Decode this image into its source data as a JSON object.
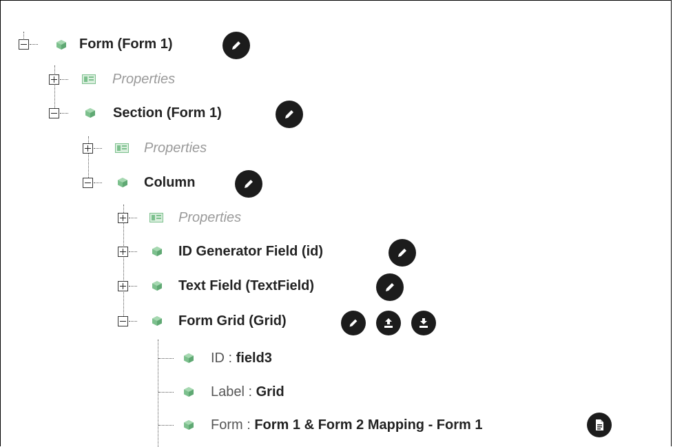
{
  "tree": {
    "root": {
      "label": "Form (Form 1)"
    },
    "root_properties": {
      "label": "Properties"
    },
    "section": {
      "label": "Section (Form 1)"
    },
    "section_properties": {
      "label": "Properties"
    },
    "column": {
      "label": "Column"
    },
    "column_properties": {
      "label": "Properties"
    },
    "id_generator": {
      "label": "ID Generator Field (id)"
    },
    "text_field": {
      "label": "Text Field (TextField)"
    },
    "form_grid": {
      "label": "Form Grid (Grid)"
    },
    "grid_props": [
      {
        "key": "ID",
        "sep": " : ",
        "value": "field3"
      },
      {
        "key": "Label",
        "sep": " : ",
        "value": "Grid"
      },
      {
        "key": "Form",
        "sep": " : ",
        "value": "Form 1 & Form 2 Mapping - Form 1"
      }
    ]
  },
  "colors": {
    "cube": "#7cc08d",
    "button": "#1c1c1c",
    "properties_text": "#9a9a9a"
  }
}
